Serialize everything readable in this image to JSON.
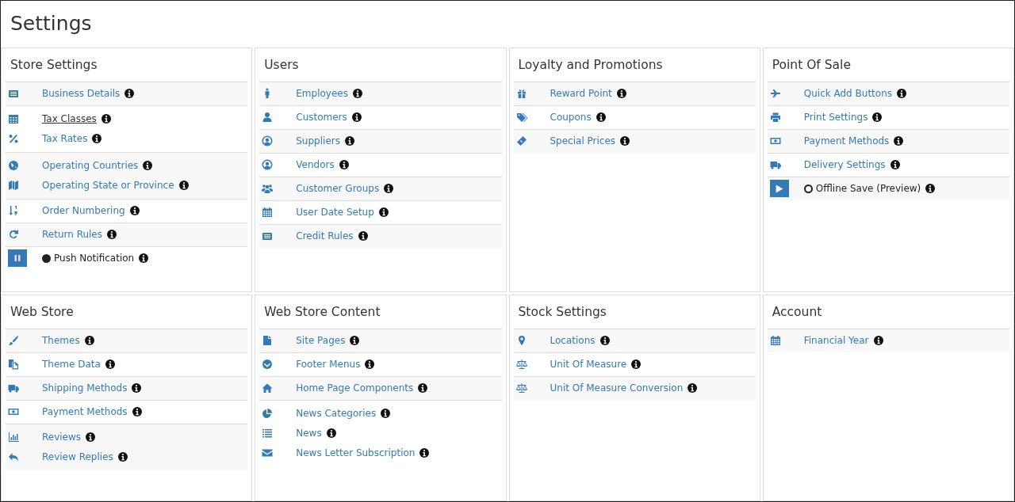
{
  "page": {
    "title": "Settings"
  },
  "panels": [
    {
      "title": "Store Settings",
      "groups": [
        {
          "items": [
            {
              "kind": "link",
              "label": "Business Details",
              "hovered": false
            }
          ]
        },
        {
          "items": [
            {
              "kind": "link",
              "label": "Tax Classes",
              "hovered": true
            },
            {
              "kind": "link",
              "label": "Tax Rates",
              "hovered": false
            }
          ]
        },
        {
          "items": [
            {
              "kind": "link",
              "label": "Operating Countries",
              "hovered": false
            },
            {
              "kind": "link",
              "label": "Operating State or Province",
              "hovered": false
            }
          ]
        },
        {
          "items": [
            {
              "kind": "link",
              "label": "Order Numbering",
              "hovered": false
            }
          ]
        },
        {
          "items": [
            {
              "kind": "link",
              "label": "Return Rules",
              "hovered": false
            }
          ]
        },
        {
          "items": [
            {
              "kind": "toggle",
              "label": "Push Notification",
              "on": true
            }
          ]
        }
      ]
    },
    {
      "title": "Users",
      "groups": [
        {
          "items": [
            {
              "kind": "link",
              "label": "Employees",
              "hovered": false
            }
          ]
        },
        {
          "items": [
            {
              "kind": "link",
              "label": "Customers",
              "hovered": false
            }
          ]
        },
        {
          "items": [
            {
              "kind": "link",
              "label": "Suppliers",
              "hovered": false
            }
          ]
        },
        {
          "items": [
            {
              "kind": "link",
              "label": "Vendors",
              "hovered": false
            }
          ]
        },
        {
          "items": [
            {
              "kind": "link",
              "label": "Customer Groups",
              "hovered": false
            }
          ]
        },
        {
          "items": [
            {
              "kind": "link",
              "label": "User Date Setup",
              "hovered": false
            }
          ]
        },
        {
          "items": [
            {
              "kind": "link",
              "label": "Credit Rules",
              "hovered": false
            }
          ]
        }
      ]
    },
    {
      "title": "Loyalty and Promotions",
      "groups": [
        {
          "items": [
            {
              "kind": "link",
              "label": "Reward Point",
              "hovered": false
            }
          ]
        },
        {
          "items": [
            {
              "kind": "link",
              "label": "Coupons",
              "hovered": false
            }
          ]
        },
        {
          "items": [
            {
              "kind": "link",
              "label": "Special Prices",
              "hovered": false
            }
          ]
        }
      ]
    },
    {
      "title": "Point Of Sale",
      "groups": [
        {
          "items": [
            {
              "kind": "link",
              "label": "Quick Add Buttons",
              "hovered": false
            }
          ]
        },
        {
          "items": [
            {
              "kind": "link",
              "label": "Print Settings",
              "hovered": false
            }
          ]
        },
        {
          "items": [
            {
              "kind": "link",
              "label": "Payment Methods",
              "hovered": false
            }
          ]
        },
        {
          "items": [
            {
              "kind": "link",
              "label": "Delivery Settings",
              "hovered": false
            }
          ]
        },
        {
          "items": [
            {
              "kind": "toggle",
              "label": "Offline Save (Preview)",
              "on": false
            }
          ]
        }
      ]
    },
    {
      "title": "Web Store",
      "groups": [
        {
          "items": [
            {
              "kind": "link",
              "label": "Themes",
              "hovered": false
            }
          ]
        },
        {
          "items": [
            {
              "kind": "link",
              "label": "Theme Data",
              "hovered": false
            }
          ]
        },
        {
          "items": [
            {
              "kind": "link",
              "label": "Shipping Methods",
              "hovered": false
            }
          ]
        },
        {
          "items": [
            {
              "kind": "link",
              "label": "Payment Methods",
              "hovered": false
            }
          ]
        },
        {
          "items": [
            {
              "kind": "link",
              "label": "Reviews",
              "hovered": false
            },
            {
              "kind": "link",
              "label": "Review Replies",
              "hovered": false
            }
          ]
        }
      ]
    },
    {
      "title": "Web Store Content",
      "groups": [
        {
          "items": [
            {
              "kind": "link",
              "label": "Site Pages",
              "hovered": false
            }
          ]
        },
        {
          "items": [
            {
              "kind": "link",
              "label": "Footer Menus",
              "hovered": false
            }
          ]
        },
        {
          "items": [
            {
              "kind": "link",
              "label": "Home Page Components",
              "hovered": false
            }
          ]
        },
        {
          "items": [
            {
              "kind": "link",
              "label": "News Categories",
              "hovered": false
            },
            {
              "kind": "link",
              "label": "News",
              "hovered": false
            },
            {
              "kind": "link",
              "label": "News Letter Subscription",
              "hovered": false
            }
          ]
        }
      ]
    },
    {
      "title": "Stock Settings",
      "groups": [
        {
          "items": [
            {
              "kind": "link",
              "label": "Locations",
              "hovered": false
            }
          ]
        },
        {
          "items": [
            {
              "kind": "link",
              "label": "Unit Of Measure",
              "hovered": false
            }
          ]
        },
        {
          "items": [
            {
              "kind": "link",
              "label": "Unit Of Measure Conversion",
              "hovered": false
            }
          ]
        }
      ]
    },
    {
      "title": "Account",
      "groups": [
        {
          "items": [
            {
              "kind": "link",
              "label": "Financial Year",
              "hovered": false
            }
          ]
        }
      ]
    }
  ]
}
